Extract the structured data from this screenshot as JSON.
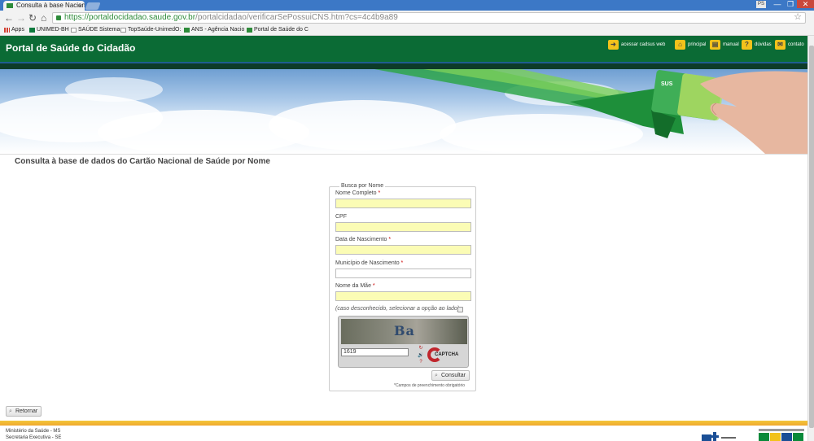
{
  "browser": {
    "tab_title": "Consulta à base Nacional",
    "tab_close": "×",
    "user_badge": "PS",
    "window_controls": [
      "—",
      "❐",
      "✕"
    ],
    "url_host": "https://portaldocidadao.saude.gov.br",
    "url_path": "/portalcidadao/verificarSePossuiCNS.htm?cs=4c4b9a89",
    "bookmarks": [
      {
        "label": "Apps",
        "icon": "apps-icon",
        "color": "#d23f31"
      },
      {
        "label": "UNIMED-BH",
        "icon": "unimed-icon",
        "color": "#0e7a3e"
      },
      {
        "label": "SAÚDE Sistema",
        "icon": "page-icon",
        "color": "#ffffff"
      },
      {
        "label": "TopSaúde-UnimedO:",
        "icon": "page-icon",
        "color": "#ffffff"
      },
      {
        "label": "ANS - Agência Nacio",
        "icon": "ans-icon",
        "color": "#2e8b3a"
      },
      {
        "label": "Portal de Saúde do C",
        "icon": "portal-icon",
        "color": "#2e8b3a"
      }
    ]
  },
  "header": {
    "title": "Portal de Saúde do Cidadão",
    "links": [
      {
        "label": "acessar cadsus web",
        "icon": "access-icon",
        "glyph": "➜"
      },
      {
        "label": "principal",
        "icon": "home-icon",
        "glyph": "⌂"
      },
      {
        "label": "manual",
        "icon": "book-icon",
        "glyph": "▤"
      },
      {
        "label": "dúvidas",
        "icon": "question-icon",
        "glyph": "?"
      },
      {
        "label": "contato",
        "icon": "mail-icon",
        "glyph": "✉"
      }
    ]
  },
  "main": {
    "heading": "Consulta à base de dados do Cartão Nacional de Saúde por Nome",
    "form": {
      "legend": "Busca por Nome",
      "fields": [
        {
          "label": "Nome Completo",
          "required": "*",
          "value": ""
        },
        {
          "label": "CPF",
          "required": "",
          "value": ""
        },
        {
          "label": "Data de Nascimento",
          "required": "*",
          "value": ""
        },
        {
          "label": "Município de Nascimento",
          "required": "*",
          "value": ""
        },
        {
          "label": "Nome da Mãe",
          "required": "*",
          "value": ""
        }
      ],
      "unknown_note": "(caso desconhecido, selecionar a opção ao lado)",
      "captcha_chars": "Ba",
      "captcha_value": "1619",
      "captcha_brand": "CAPTCHA",
      "captcha_buttons": [
        "↻",
        "🔊",
        "?"
      ],
      "submit_label": "Consultar",
      "required_note": "*Campos de preenchimento obrigatório"
    },
    "back_label": "Retornar"
  },
  "footer": {
    "line1": "Ministério da Saúde - MS",
    "line2": "Secretaria Executiva - SE"
  }
}
